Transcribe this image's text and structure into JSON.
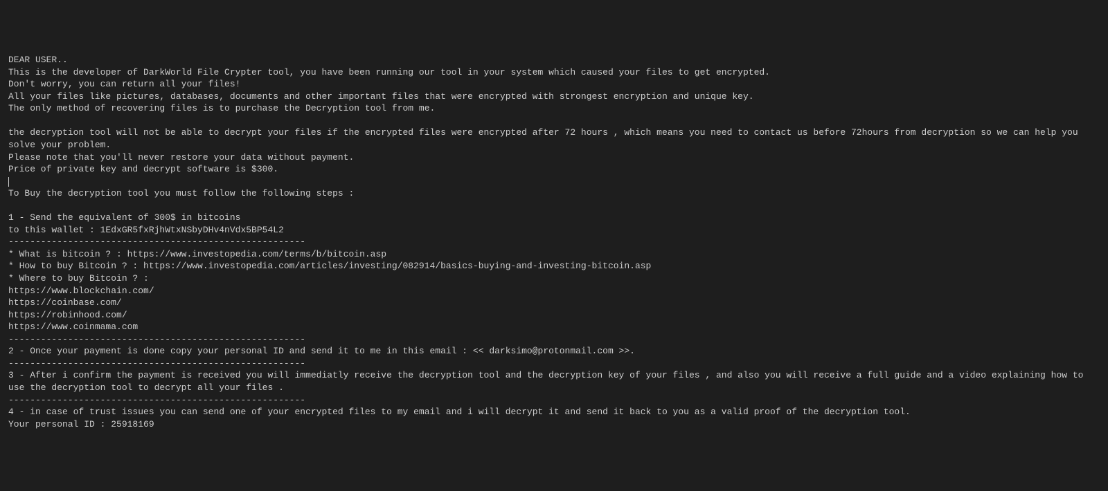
{
  "header": "DEAR USER..",
  "intro_line1": "This is the developer of DarkWorld File Crypter tool, you have been running our tool in your system which caused your files to get encrypted.",
  "intro_line2": "Don't worry, you can return all your files!",
  "intro_line3": "All your files like pictures, databases, documents and other important files that were encrypted with strongest encryption and unique key.",
  "intro_line4": "The only method of recovering files is to purchase the Decryption tool from me.",
  "warning_line1": "the decryption tool will not be able to decrypt your files if the encrypted files were encrypted after 72 hours , which means you need to contact us before 72hours from decryption so we can help you solve your problem.",
  "warning_line2": "Please note that you'll never restore your data without payment.",
  "price_line": "Price of private key and decrypt software is $300.",
  "steps_header": "To Buy the decryption tool you must follow the following steps :",
  "step1_line1": "1 - Send the equivalent of 300$ in bitcoins",
  "step1_line2": "to this wallet : 1EdxGR5fxRjhWtxNSbyDHv4nVdx5BP54L2",
  "divider": "-------------------------------------------------------",
  "bitcoin_info1": "* What is bitcoin ? : https://www.investopedia.com/terms/b/bitcoin.asp",
  "bitcoin_info2": "* How to buy Bitcoin ? : https://www.investopedia.com/articles/investing/082914/basics-buying-and-investing-bitcoin.asp",
  "bitcoin_info3": "* Where to buy Bitcoin ? :",
  "link1": "https://www.blockchain.com/",
  "link2": "https://coinbase.com/",
  "link3": "https://robinhood.com/",
  "link4": "https://www.coinmama.com",
  "step2": "2 - Once your payment is done copy your personal ID and send it to me in this email : << darksimo@protonmail.com >>.",
  "step3": "3 - After i confirm the payment is received you will immediatly receive the decryption tool and the decryption key of your files , and also you will receive a full guide and a video explaining how to use the decryption tool to decrypt all your files .",
  "step4": "4 - in case of trust issues you can send one of your encrypted files to my email and i will decrypt it and send it back to you as a valid proof of the decryption tool.",
  "personal_id": "Your personal ID : 25918169"
}
